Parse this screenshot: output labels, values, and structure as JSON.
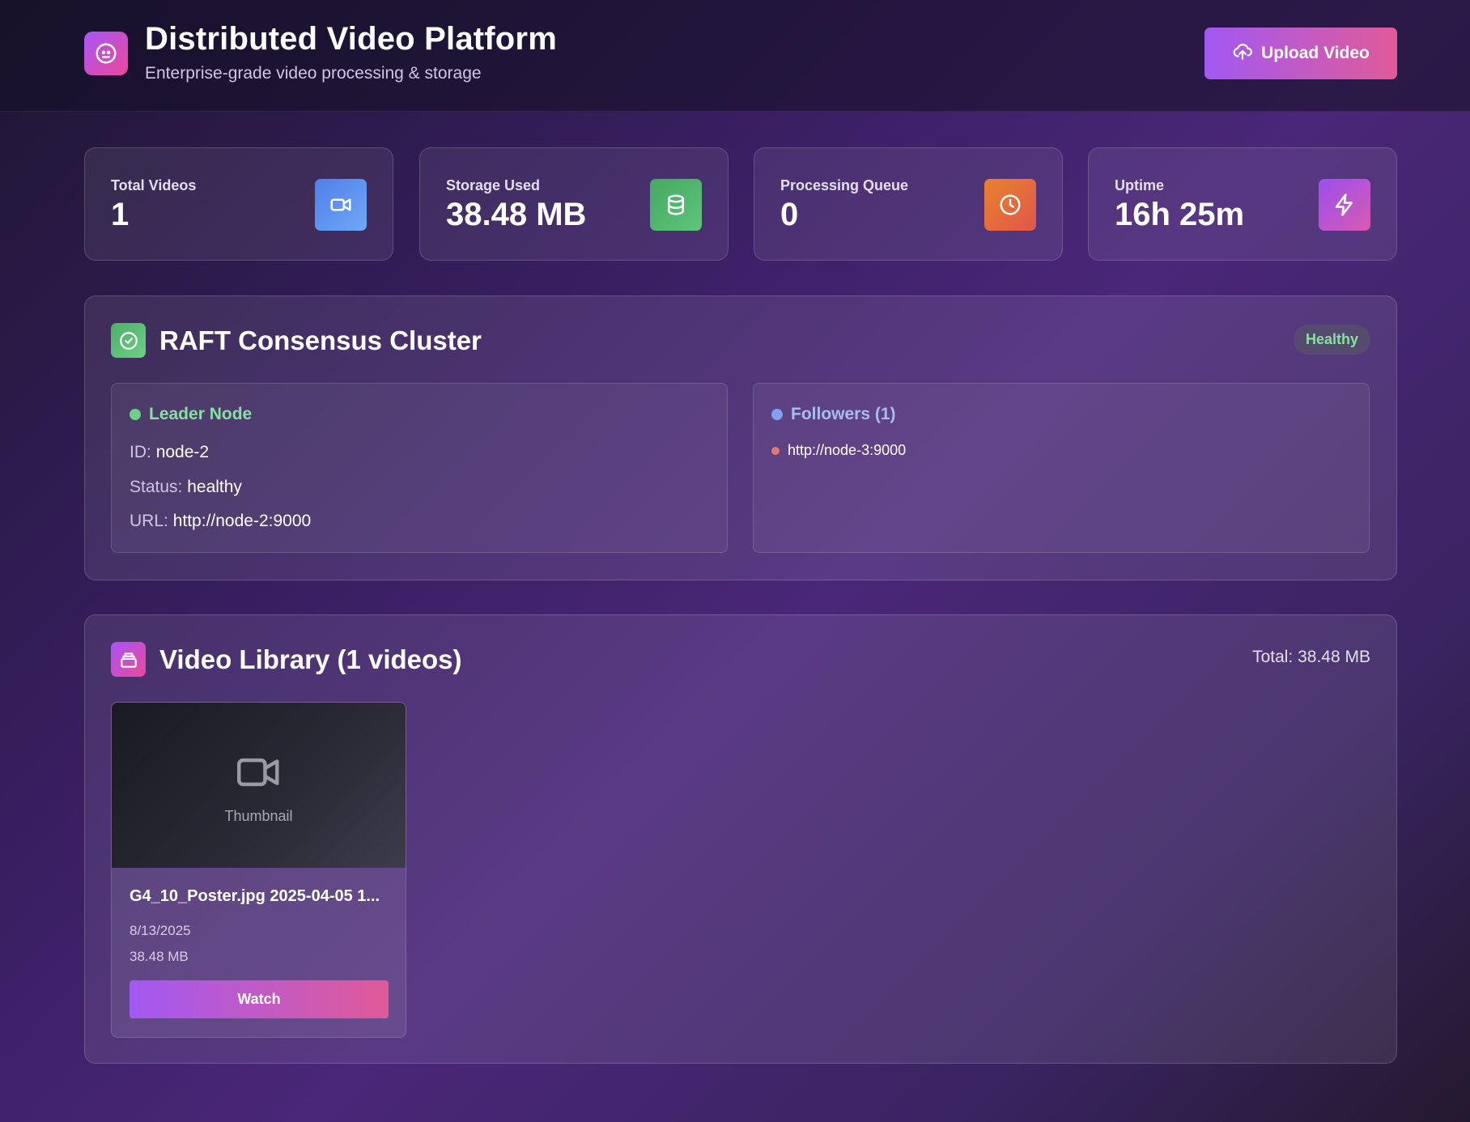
{
  "header": {
    "title": "Distributed Video Platform",
    "subtitle": "Enterprise-grade video processing & storage",
    "logo_icon": "robot-face-icon",
    "upload_label": "Upload Video",
    "upload_icon": "cloud-upload-icon"
  },
  "stats": [
    {
      "label": "Total Videos",
      "value": "1",
      "icon": "video-camera-icon",
      "color": "#5b8def"
    },
    {
      "label": "Storage Used",
      "value": "38.48 MB",
      "icon": "database-icon",
      "color": "#4caf68"
    },
    {
      "label": "Processing Queue",
      "value": "0",
      "icon": "clock-icon",
      "color": "#e8733a"
    },
    {
      "label": "Uptime",
      "value": "16h 25m",
      "icon": "lightning-icon",
      "color": "#a855f7"
    }
  ],
  "cluster": {
    "title": "RAFT Consensus Cluster",
    "status_badge": "Healthy",
    "icon": "check-circle-icon",
    "leader": {
      "heading": "Leader Node",
      "id_label": "ID:",
      "id_value": "node-2",
      "status_label": "Status:",
      "status_value": "healthy",
      "url_label": "URL:",
      "url_value": "http://node-2:9000"
    },
    "followers": {
      "heading": "Followers (1)",
      "items": [
        "http://node-3:9000"
      ]
    }
  },
  "library": {
    "title": "Video Library (1 videos)",
    "total": "Total: 38.48 MB",
    "icon": "archive-icon",
    "videos": [
      {
        "thumbnail_label": "Thumbnail",
        "title": "G4_10_Poster.jpg 2025-04-05 1...",
        "date": "8/13/2025",
        "size": "38.48 MB",
        "watch_label": "Watch"
      }
    ]
  },
  "colors": {
    "accent_gradient_start": "#a259f2",
    "accent_gradient_end": "#e05a98",
    "leader_dot": "#6fcf86",
    "followers_dot": "#7ea2f0",
    "follower_item_dot": "#e07a6e",
    "healthy_text": "#86e0a0"
  }
}
